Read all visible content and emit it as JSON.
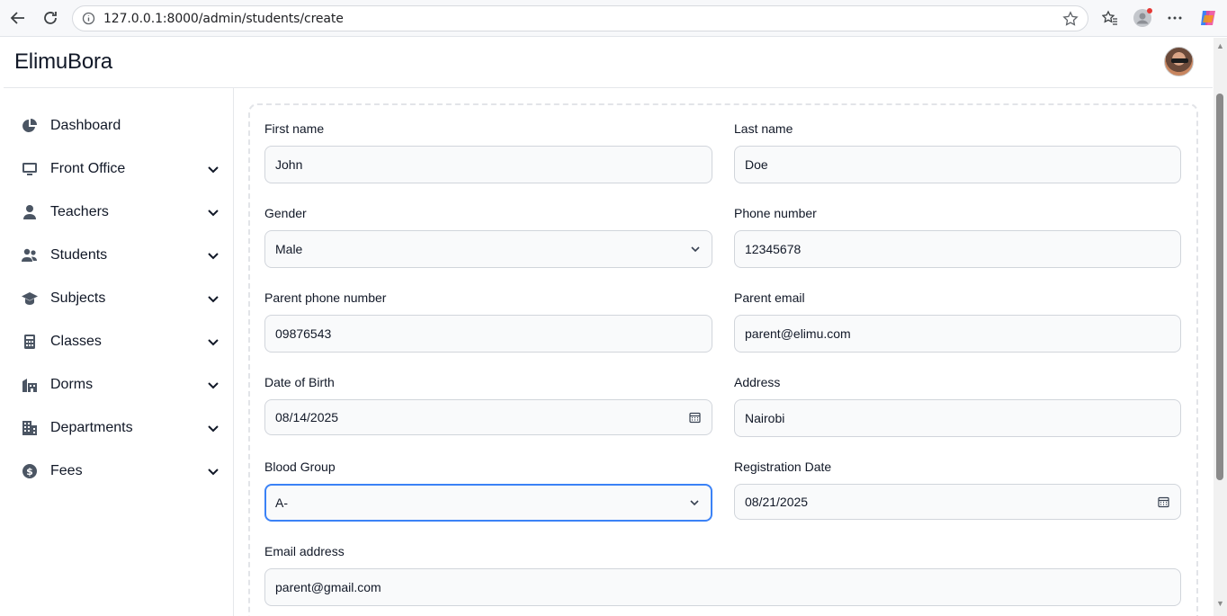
{
  "browser": {
    "url": "127.0.0.1:8000/admin/students/create"
  },
  "app": {
    "brand": "ElimuBora"
  },
  "sidebar": {
    "items": [
      {
        "label": "Dashboard",
        "icon": "pie-chart-icon",
        "has_chevron": false
      },
      {
        "label": "Front Office",
        "icon": "monitor-icon",
        "has_chevron": true
      },
      {
        "label": "Teachers",
        "icon": "user-icon",
        "has_chevron": true
      },
      {
        "label": "Students",
        "icon": "users-icon",
        "has_chevron": true
      },
      {
        "label": "Subjects",
        "icon": "graduation-cap-icon",
        "has_chevron": true
      },
      {
        "label": "Classes",
        "icon": "calculator-icon",
        "has_chevron": true
      },
      {
        "label": "Dorms",
        "icon": "building-icon",
        "has_chevron": true
      },
      {
        "label": "Departments",
        "icon": "office-building-icon",
        "has_chevron": true
      },
      {
        "label": "Fees",
        "icon": "dollar-circle-icon",
        "has_chevron": true
      }
    ]
  },
  "form": {
    "first_name": {
      "label": "First name",
      "value": "John"
    },
    "last_name": {
      "label": "Last name",
      "value": "Doe"
    },
    "gender": {
      "label": "Gender",
      "value": "Male"
    },
    "phone": {
      "label": "Phone number",
      "value": "12345678"
    },
    "parent_phone": {
      "label": "Parent phone number",
      "value": "09876543"
    },
    "parent_email": {
      "label": "Parent email",
      "value": "parent@elimu.com"
    },
    "dob": {
      "label": "Date of Birth",
      "value": "08/14/2025"
    },
    "address": {
      "label": "Address",
      "value": "Nairobi"
    },
    "blood_group": {
      "label": "Blood Group",
      "value": "A-"
    },
    "registration_date": {
      "label": "Registration Date",
      "value": "08/21/2025"
    },
    "email": {
      "label": "Email address",
      "value": "parent@gmail.com"
    }
  },
  "colors": {
    "focus_ring": "#3b82f6",
    "input_bg": "#f9fafb"
  }
}
